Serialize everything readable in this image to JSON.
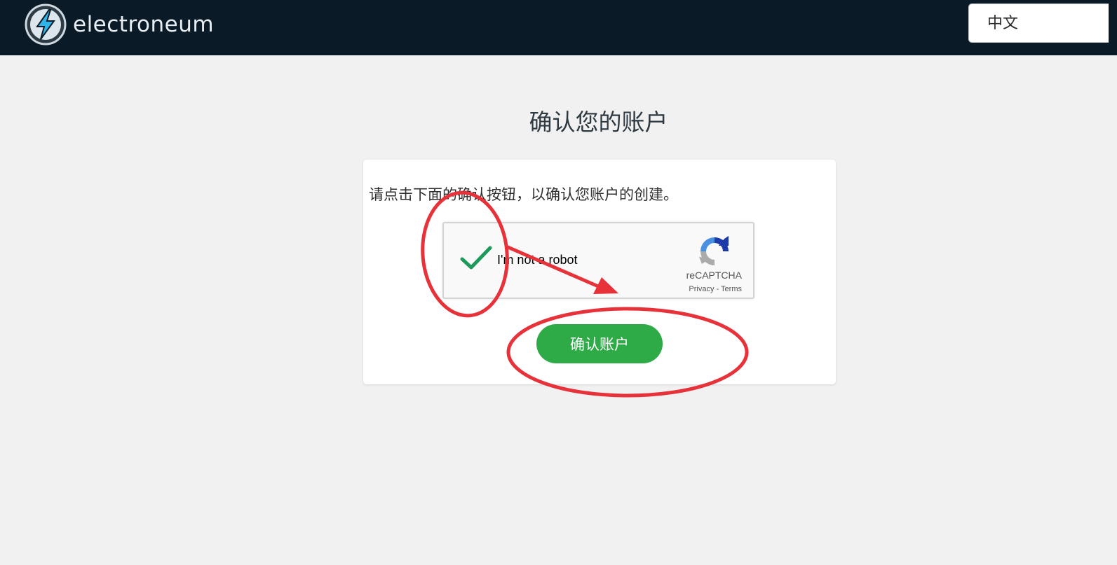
{
  "header": {
    "brand": "electroneum",
    "language_selected": "中文"
  },
  "main": {
    "title": "确认您的账户",
    "instruction": "请点击下面的确认按钮，以确认您账户的创建。",
    "confirm_label": "确认账户"
  },
  "recaptcha": {
    "label": "I'm not a robot",
    "brand": "reCAPTCHA",
    "privacy": "Privacy",
    "separator": " - ",
    "terms": "Terms"
  },
  "colors": {
    "header_bg": "#0a1a27",
    "page_bg": "#f1f1f1",
    "button_green": "#2eaa47",
    "checkmark_green": "#1d9a5a",
    "annotation_red": "#e8323a",
    "logo_blue": "#2fb6e9"
  },
  "icons": {
    "logo": "electroneum-bolt-logo-icon",
    "check": "checkmark-icon",
    "recaptcha": "recaptcha-logo-icon"
  }
}
